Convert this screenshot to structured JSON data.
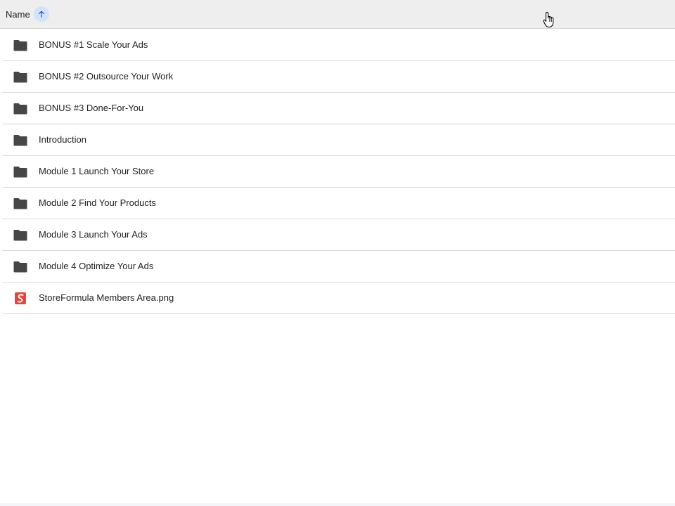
{
  "header": {
    "column_name": "Name",
    "sort_icon": "arrow-up-icon",
    "accent_color": "#1a73e8"
  },
  "files": [
    {
      "name": "BONUS #1 Scale Your Ads",
      "type": "folder",
      "icon": "folder-icon"
    },
    {
      "name": "BONUS #2 Outsource Your Work",
      "type": "folder",
      "icon": "folder-icon"
    },
    {
      "name": "BONUS #3 Done-For-You",
      "type": "folder",
      "icon": "folder-icon"
    },
    {
      "name": "Introduction",
      "type": "folder",
      "icon": "folder-icon"
    },
    {
      "name": "Module 1 Launch Your Store",
      "type": "folder",
      "icon": "folder-icon"
    },
    {
      "name": "Module 2 Find Your Products",
      "type": "folder",
      "icon": "folder-icon"
    },
    {
      "name": "Module 3 Launch Your Ads",
      "type": "folder",
      "icon": "folder-icon"
    },
    {
      "name": "Module 4 Optimize Your Ads",
      "type": "folder",
      "icon": "folder-icon"
    },
    {
      "name": "StoreFormula Members Area.png",
      "type": "image",
      "icon": "image-file-icon"
    }
  ],
  "colors": {
    "folder": "#444746",
    "image_file": "#ea4335"
  }
}
